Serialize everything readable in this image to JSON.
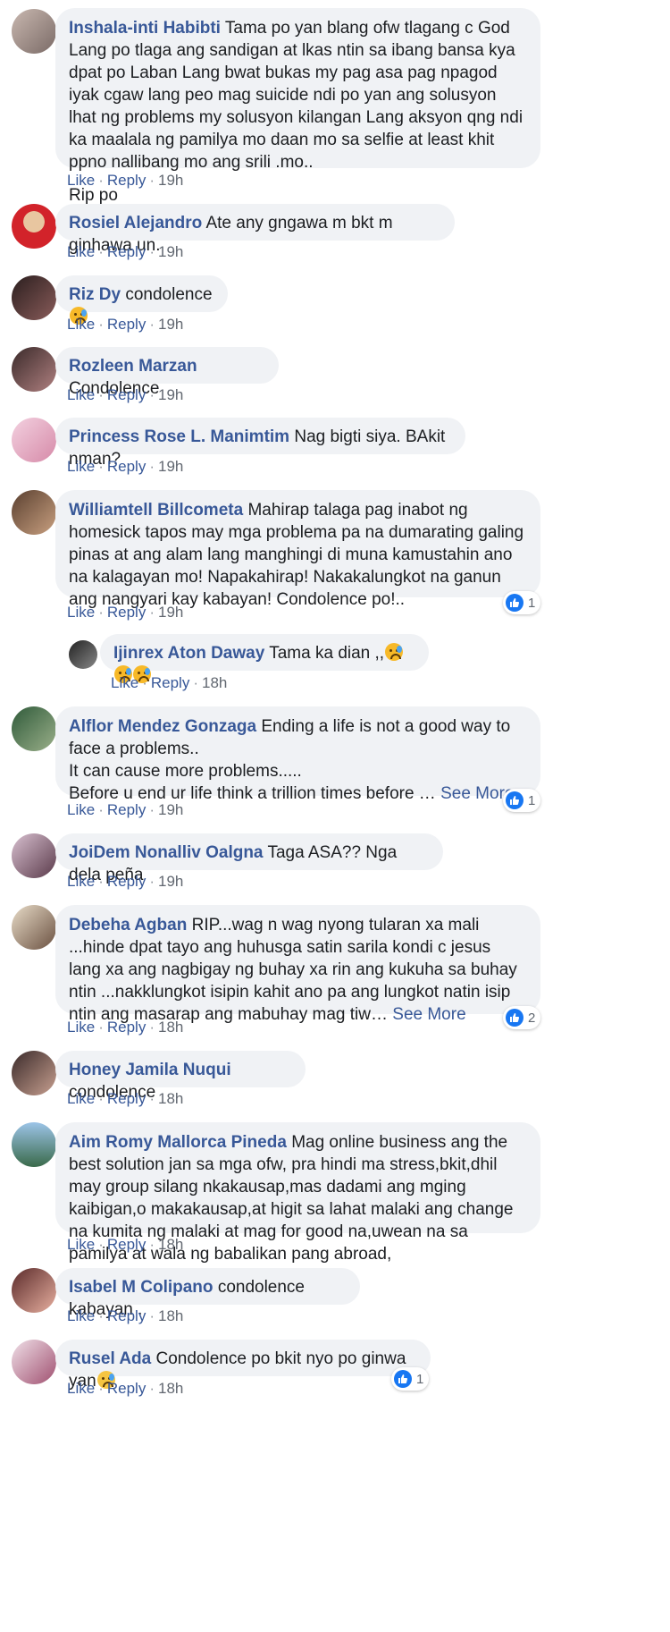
{
  "actions": {
    "like": "Like",
    "reply": "Reply",
    "separator": "·"
  },
  "comments": [
    {
      "author": "Inshala-inti Habibti",
      "text": "Tama po yan blang ofw tlagang c God Lang po tlaga ang sandigan at lkas ntin sa ibang bansa kya dpat po Laban Lang bwat bukas my pag asa pag npagod iyak cgaw lang peo mag suicide ndi po yan ang solusyon lhat ng problems my solusyon kilangan Lang aksyon qng ndi ka maalala ng pamilya mo daan mo sa selfie at least khit ppno nallibang mo ang srili .mo..",
      "text2": "Rip po",
      "time": "19h"
    },
    {
      "author": "Rosiel Alejandro",
      "text": "Ate any gngawa m bkt m ginhawa un.",
      "time": "19h"
    },
    {
      "author": "Riz Dy",
      "text": "condolence",
      "emoji": "sad-face-emoji",
      "time": "19h"
    },
    {
      "author": "Rozleen Marzan",
      "text": "Condolence",
      "time": "19h"
    },
    {
      "author": "Princess Rose L. Manimtim",
      "text": "Nag bigti siya. BAkit nman?",
      "time": "19h"
    },
    {
      "author": "Williamtell Billcometa",
      "text": "Mahirap talaga pag inabot ng homesick tapos may mga problema pa na dumarating galing pinas at ang alam lang manghingi di muna kamustahin ano na kalagayan mo! Napakahirap! Nakakalungkot na ganun ang nangyari kay kabayan! Condolence po!..",
      "time": "19h",
      "reactions": "1"
    },
    {
      "author": "Ijinrex Aton Daway",
      "text": "Tama ka dian ,,",
      "emoji": "sad-face-emoji",
      "time": "18h"
    },
    {
      "author": "Alflor Mendez Gonzaga",
      "text": "Ending a life is not a good way to face a problems..",
      "text2": "It can cause more problems.....",
      "text3": "Before u end ur life think a trillion times before … ",
      "see_more": "See More",
      "time": "19h",
      "reactions": "1"
    },
    {
      "author": "JoiDem Nonalliv Oalgna",
      "text": "Taga ASA?? Nga dela peña",
      "time": "19h"
    },
    {
      "author": "Debeha Agban",
      "text": "RIP...wag n wag nyong tularan xa mali ...hinde dpat tayo ang huhusga satin sarila kondi c jesus lang xa ang nagbigay ng buhay xa rin ang kukuha sa buhay ntin ...nakklungkot isipin kahit ano pa ang lungkot natin isip ntin ang masarap ang mabuhay mag tiw… ",
      "see_more": "See More",
      "time": "18h",
      "reactions": "2"
    },
    {
      "author": "Honey Jamila Nuqui",
      "text": "condolence",
      "time": "18h"
    },
    {
      "author": "Aim Romy Mallorca Pineda",
      "text": "Mag online business ang the best solution jan sa mga ofw, pra hindi ma stress,bkit,dhil may group silang nkakausap,mas dadami ang mging kaibigan,o makakausap,at higit sa lahat malaki ang change na kumita ng malaki at mag for good na,uwean na sa pamilya at wala ng babalikan pang abroad,",
      "time": "18h"
    },
    {
      "author": "Isabel M Colipano",
      "text": "condolence kabayan .",
      "time": "18h"
    },
    {
      "author": "Rusel Ada",
      "text": "Condolence po bkit nyo po ginwa yan",
      "emoji": "anxious-face-emoji",
      "time": "18h",
      "reactions": "1"
    }
  ]
}
